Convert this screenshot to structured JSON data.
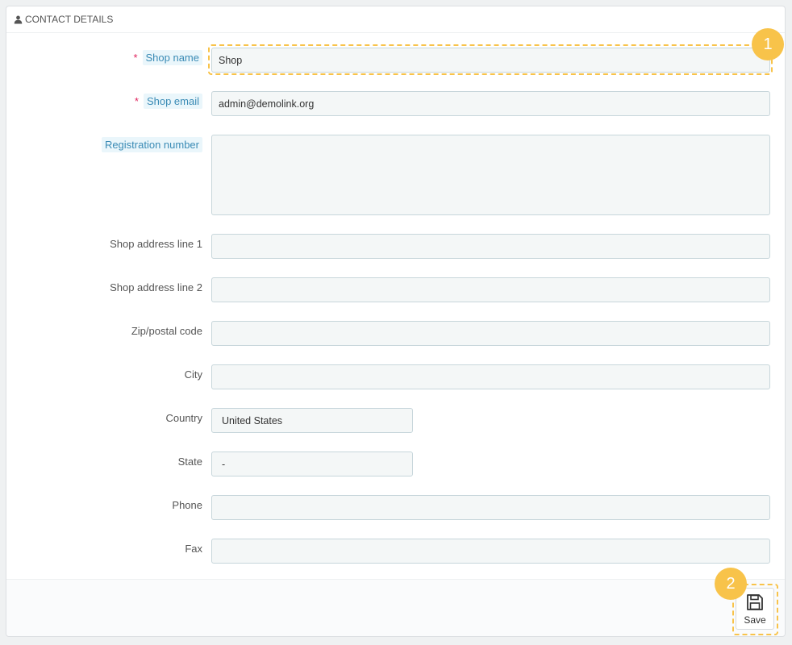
{
  "panel": {
    "title": "Contact details"
  },
  "fields": {
    "shop_name": {
      "label": "Shop name",
      "value": "Shop"
    },
    "shop_email": {
      "label": "Shop email",
      "value": "admin@demolink.org"
    },
    "registration_number": {
      "label": "Registration number",
      "value": ""
    },
    "address1": {
      "label": "Shop address line 1",
      "value": ""
    },
    "address2": {
      "label": "Shop address line 2",
      "value": ""
    },
    "zip": {
      "label": "Zip/postal code",
      "value": ""
    },
    "city": {
      "label": "City",
      "value": ""
    },
    "country": {
      "label": "Country",
      "value": "United States"
    },
    "state": {
      "label": "State",
      "value": "-"
    },
    "phone": {
      "label": "Phone",
      "value": ""
    },
    "fax": {
      "label": "Fax",
      "value": ""
    }
  },
  "required_marker": "*",
  "footer": {
    "save_label": "Save"
  },
  "badges": {
    "first": "1",
    "second": "2"
  },
  "colors": {
    "highlight": "#f8c34a",
    "hint_bg": "#eaf6fb",
    "hint_text": "#3a8bb5",
    "required": "#e0245e"
  },
  "icons": {
    "heading": "user-icon",
    "save": "floppy-disk-icon"
  }
}
